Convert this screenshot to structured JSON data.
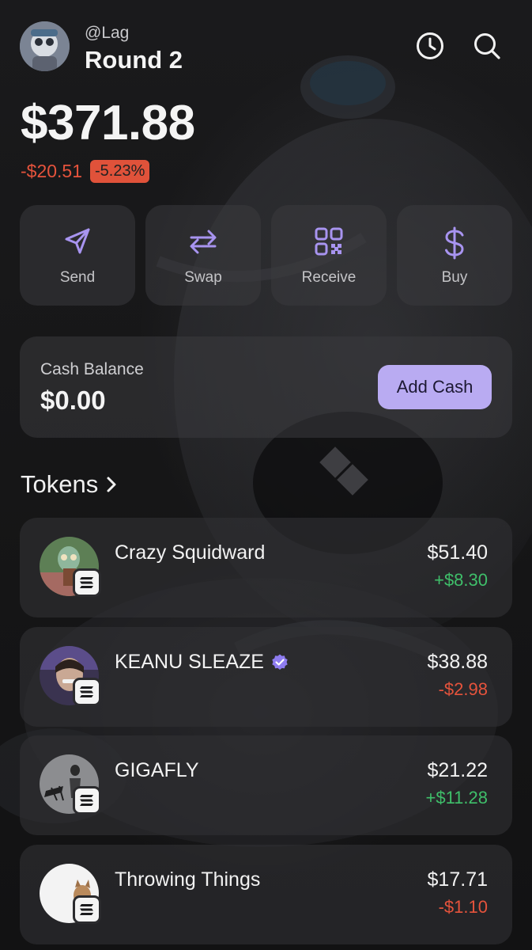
{
  "colors": {
    "accent": "#b9abf2",
    "positive": "#3fbf6a",
    "negative": "#e5533c",
    "card": "#3a3a3e",
    "icon_purple": "#a894f0"
  },
  "header": {
    "handle": "@Lag",
    "account_name": "Round 2",
    "icons": [
      "clock-icon",
      "search-icon"
    ]
  },
  "portfolio": {
    "balance": "$371.88",
    "change_abs": "-$20.51",
    "change_pct": "-5.23%"
  },
  "actions": [
    {
      "label": "Send",
      "icon": "send-icon"
    },
    {
      "label": "Swap",
      "icon": "swap-icon"
    },
    {
      "label": "Receive",
      "icon": "qr-code-icon"
    },
    {
      "label": "Buy",
      "icon": "dollar-icon"
    }
  ],
  "cash": {
    "label": "Cash Balance",
    "value": "$0.00",
    "button": "Add Cash"
  },
  "tokens": {
    "title": "Tokens",
    "items": [
      {
        "name": "Crazy Squidward",
        "price": "$51.40",
        "change": "+$8.30",
        "direction": "up",
        "verified": false,
        "chain": "solana"
      },
      {
        "name": "KEANU SLEAZE",
        "price": "$38.88",
        "change": "-$2.98",
        "direction": "down",
        "verified": true,
        "chain": "solana"
      },
      {
        "name": "GIGAFLY",
        "price": "$21.22",
        "change": "+$11.28",
        "direction": "up",
        "verified": false,
        "chain": "solana"
      },
      {
        "name": "Throwing Things",
        "price": "$17.71",
        "change": "-$1.10",
        "direction": "down",
        "verified": false,
        "chain": "solana"
      }
    ]
  }
}
